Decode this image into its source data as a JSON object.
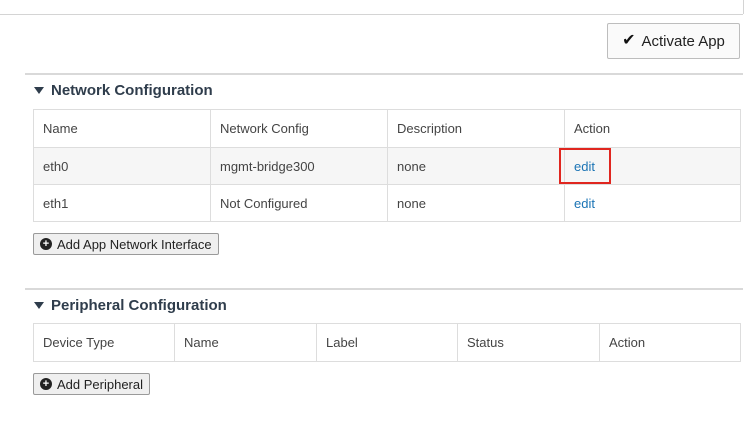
{
  "toolbar": {
    "activate_label": "Activate App"
  },
  "network_section": {
    "title": "Network Configuration",
    "headers": [
      "Name",
      "Network Config",
      "Description",
      "Action"
    ],
    "rows": [
      {
        "name": "eth0",
        "config": "mgmt-bridge300",
        "description": "none",
        "action": "edit"
      },
      {
        "name": "eth1",
        "config": "Not Configured",
        "description": "none",
        "action": "edit"
      }
    ],
    "add_button_label": "Add App Network Interface"
  },
  "peripheral_section": {
    "title": "Peripheral Configuration",
    "headers": [
      "Device Type",
      "Name",
      "Label",
      "Status",
      "Action"
    ],
    "add_button_label": "Add Peripheral"
  },
  "colors": {
    "link": "#1b74b5",
    "highlight": "#e0261f",
    "section_title": "#2f3d4c"
  }
}
